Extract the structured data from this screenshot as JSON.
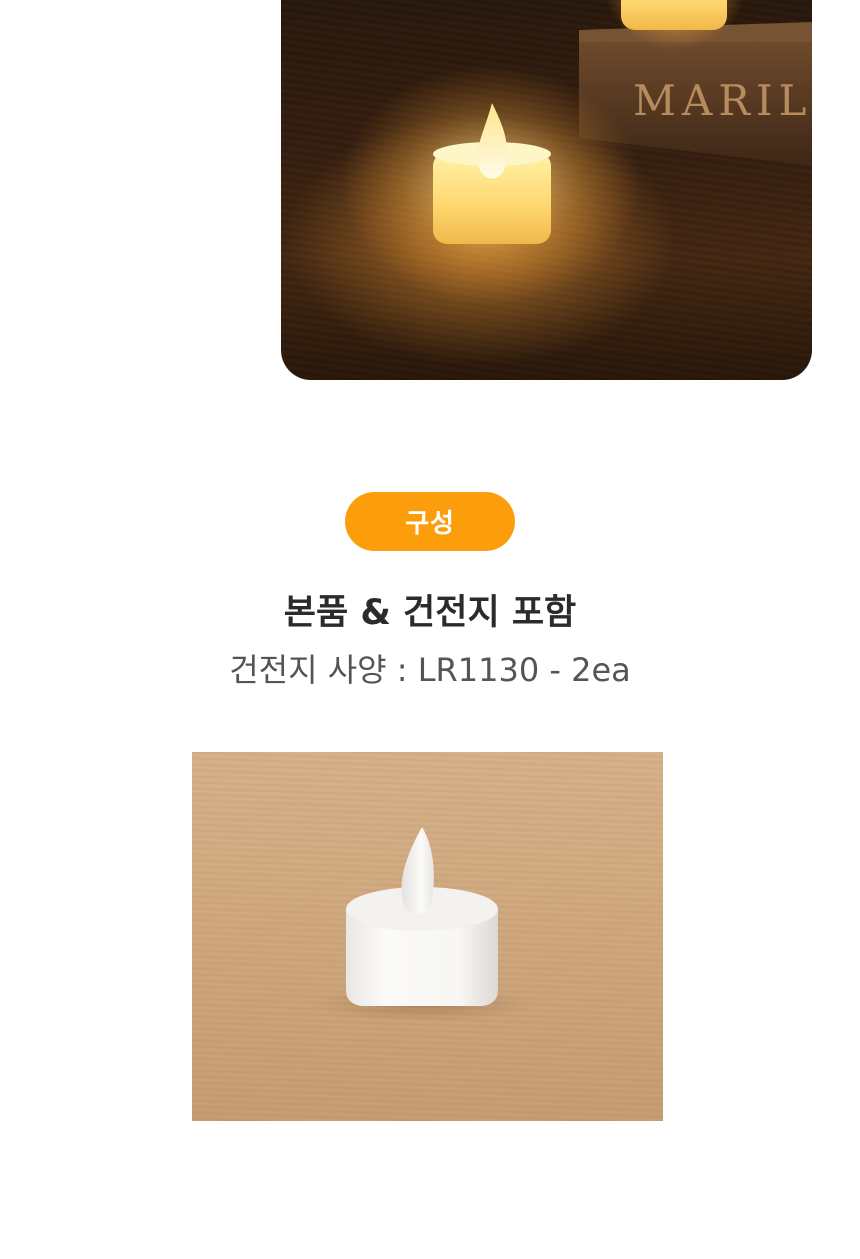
{
  "top_photo": {
    "alt": "LED 티라이트 캔들",
    "box_text": "MARILI"
  },
  "badge": {
    "label": "구성"
  },
  "headline": "본품 & 건전지 포함",
  "subline": "건전지 사양 : LR1130 - 2ea",
  "bottom_photo": {
    "alt": "LED 티라이트 본품"
  },
  "colors": {
    "badge_bg": "#fc9e0c",
    "headline": "#2b2b2b",
    "subline": "#555555"
  }
}
